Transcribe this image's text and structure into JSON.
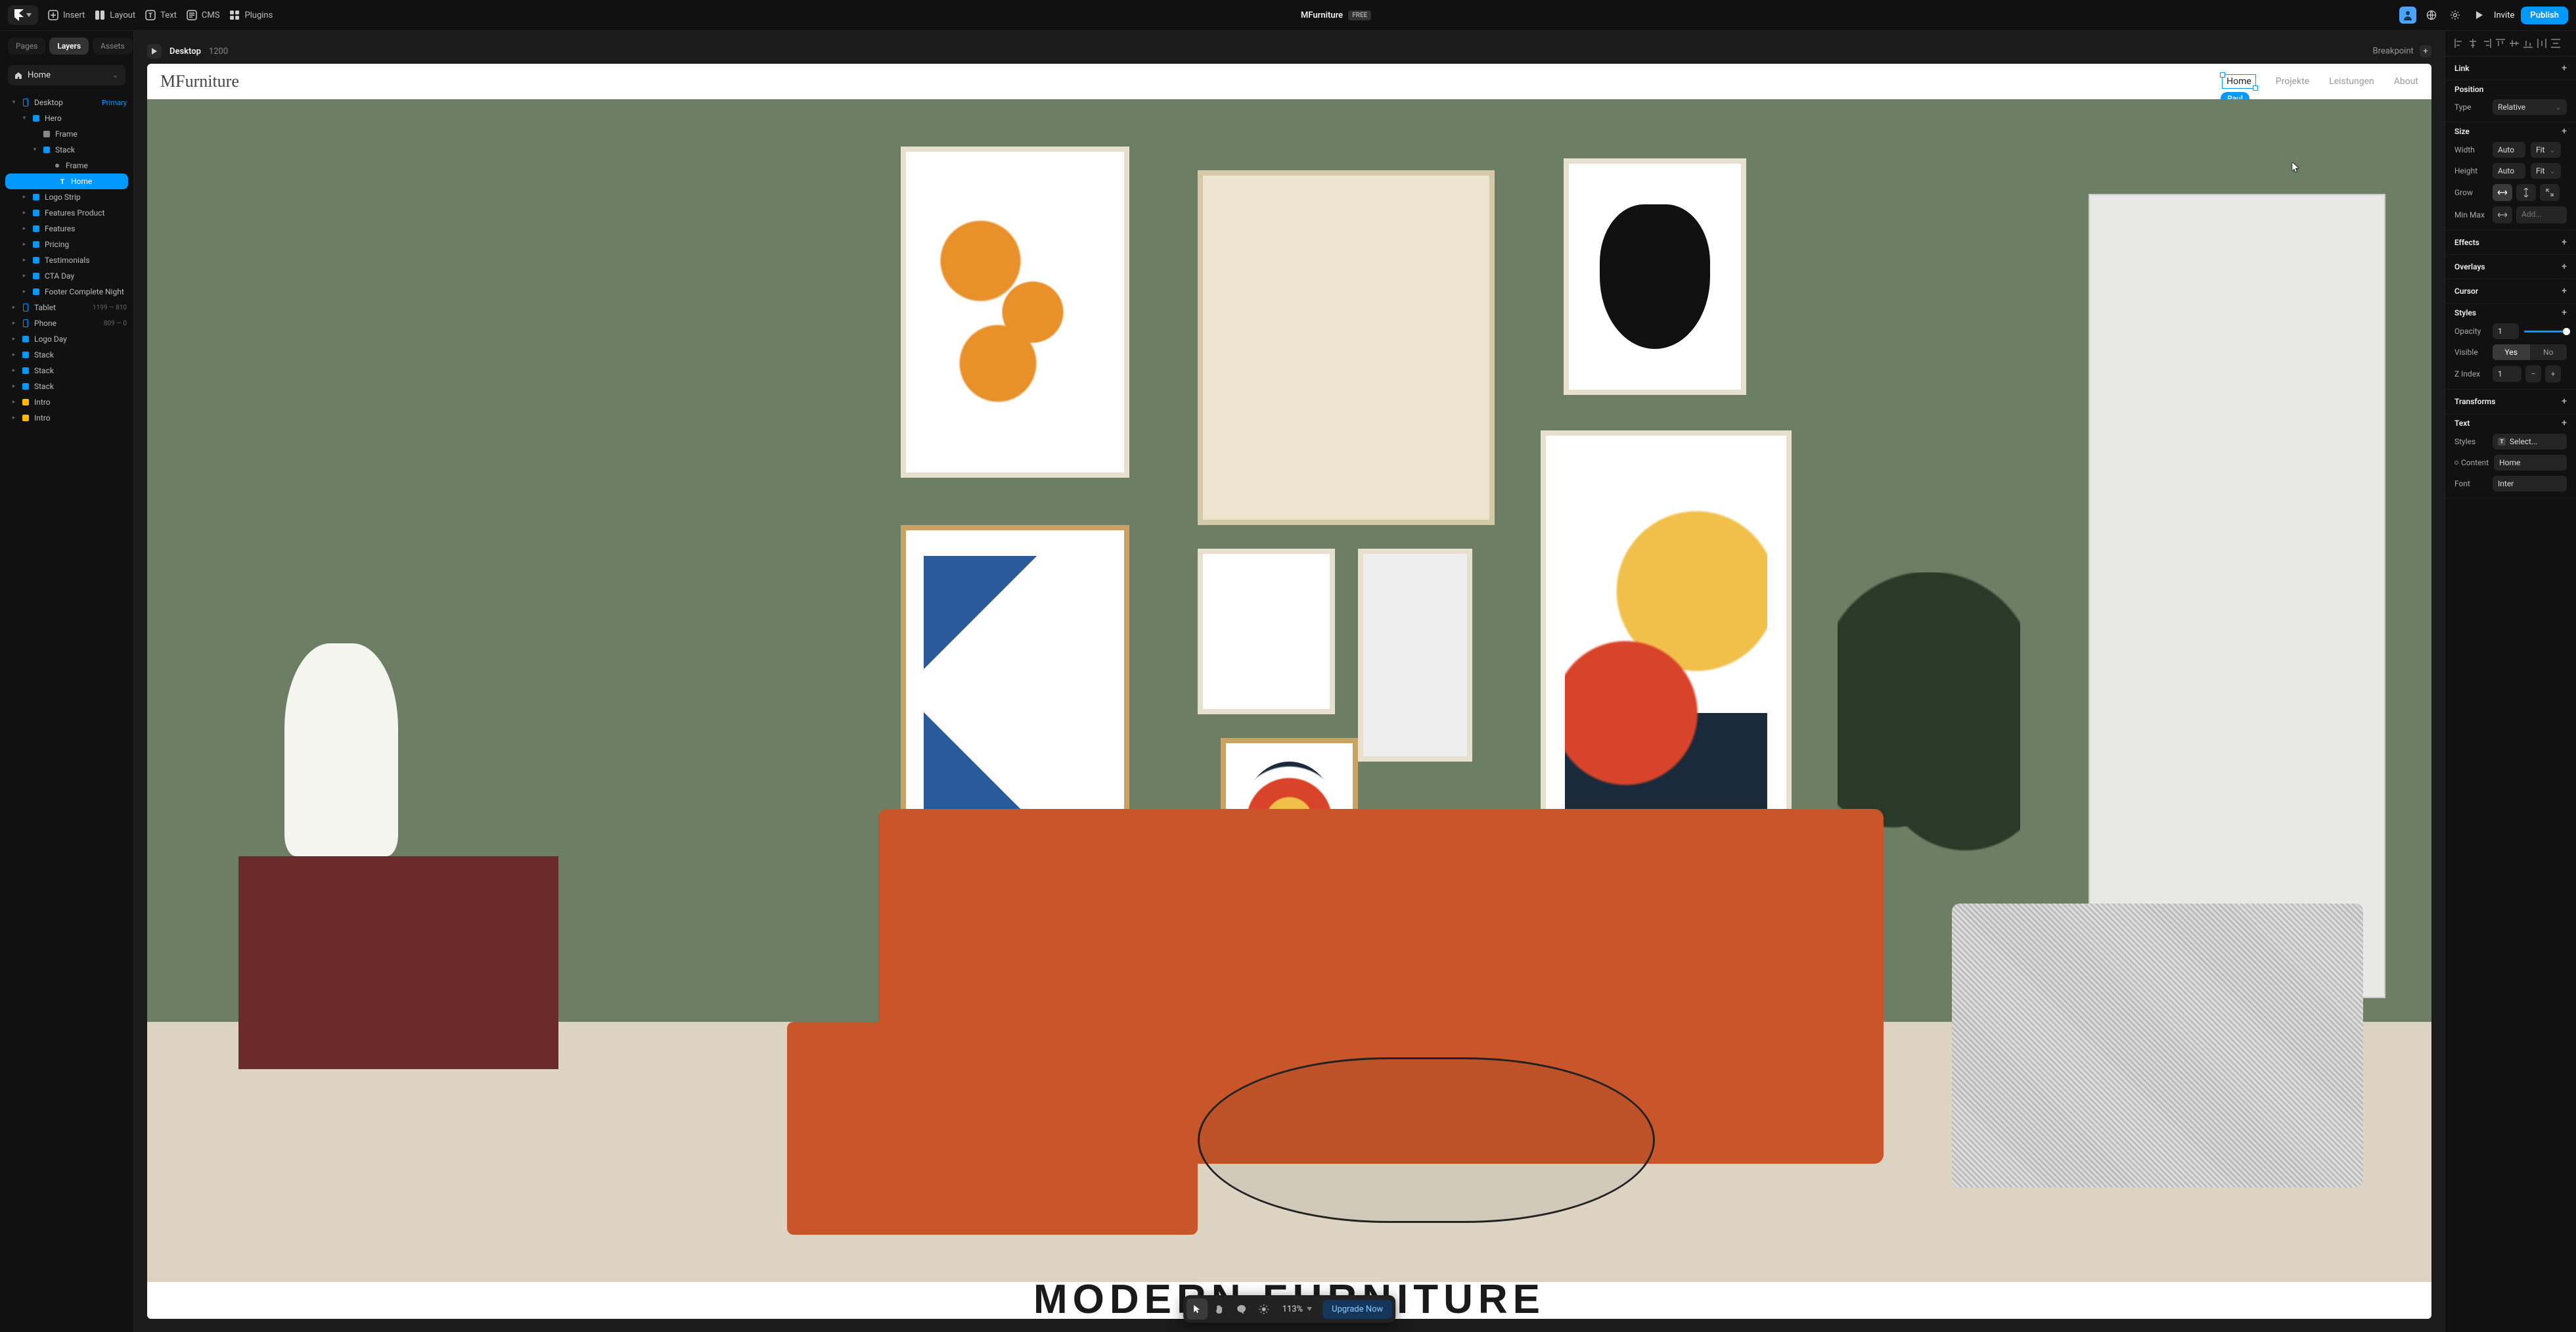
{
  "topbar": {
    "tools": {
      "insert": "Insert",
      "layout": "Layout",
      "text": "Text",
      "cms": "CMS",
      "plugins": "Plugins"
    },
    "project": "MFurniture",
    "badge": "FREE",
    "invite": "Invite",
    "publish": "Publish"
  },
  "left": {
    "tabs": {
      "pages": "Pages",
      "layers": "Layers",
      "assets": "Assets"
    },
    "page": "Home",
    "tree": {
      "desktop": "Desktop",
      "desktop_tag": "Primary",
      "hero": "Hero",
      "frame1": "Frame",
      "stack1": "Stack",
      "frame2": "Frame",
      "home": "Home",
      "logostrip": "Logo Strip",
      "featprod": "Features Product",
      "features": "Features",
      "pricing": "Pricing",
      "testimonials": "Testimonials",
      "ctaday": "CTA Day",
      "footer": "Footer Complete Night",
      "tablet": "Tablet",
      "tablet_dim": "1199 — 810",
      "phone": "Phone",
      "phone_dim": "809 — 0",
      "logoday": "Logo Day",
      "stack2": "Stack",
      "stack3": "Stack",
      "stack4": "Stack",
      "intro1": "Intro",
      "intro2": "Intro"
    }
  },
  "canvas": {
    "breakpoint_label": "Desktop",
    "breakpoint_size": "1200",
    "breakpoint_btn": "Breakpoint",
    "site_logo": "MFurniture",
    "nav": {
      "home": "Home",
      "projekte": "Projekte",
      "leistungen": "Leistungen",
      "about": "About"
    },
    "collaborator": "Paul",
    "hero_title": "MODERN FURNITURE"
  },
  "bottombar": {
    "zoom": "113%",
    "upgrade": "Upgrade Now"
  },
  "right": {
    "sections": {
      "link": "Link",
      "position": "Position",
      "size": "Size",
      "effects": "Effects",
      "overlays": "Overlays",
      "cursor": "Cursor",
      "styles": "Styles",
      "transforms": "Transforms",
      "text": "Text"
    },
    "position": {
      "type_lbl": "Type",
      "type_val": "Relative"
    },
    "size": {
      "width_lbl": "Width",
      "width_val": "Auto",
      "width_fit": "Fit",
      "height_lbl": "Height",
      "height_val": "Auto",
      "height_fit": "Fit",
      "grow_lbl": "Grow",
      "minmax_lbl": "Min Max",
      "minmax_add": "Add..."
    },
    "styles": {
      "opacity_lbl": "Opacity",
      "opacity_val": "1",
      "visible_lbl": "Visible",
      "visible_yes": "Yes",
      "visible_no": "No",
      "zindex_lbl": "Z Index",
      "zindex_val": "1"
    },
    "text": {
      "styles_lbl": "Styles",
      "styles_val": "Select...",
      "content_lbl": "Content",
      "content_val": "Home",
      "font_lbl": "Font",
      "font_val": "Inter"
    }
  }
}
